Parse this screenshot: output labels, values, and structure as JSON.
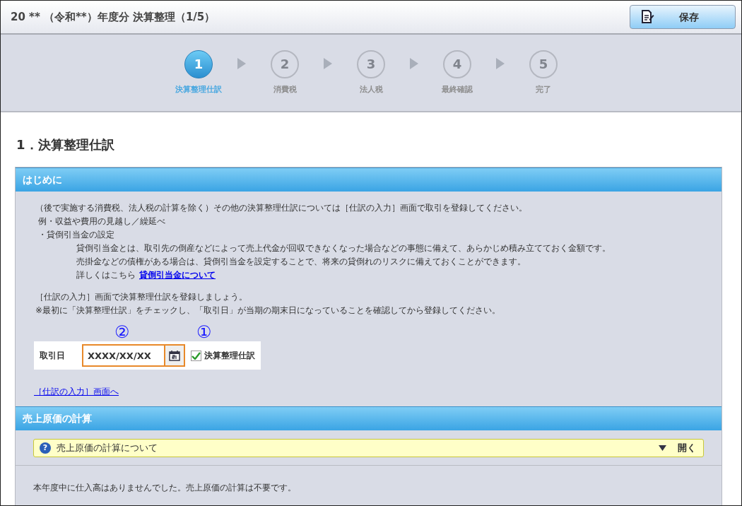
{
  "header": {
    "title": "20 ** （令和**）年度分 決算整理（1/5）",
    "save_button": "保存"
  },
  "steps": [
    {
      "number": "1",
      "label": "決算整理仕訳",
      "selected": true
    },
    {
      "number": "2",
      "label": "消費税",
      "selected": false
    },
    {
      "number": "3",
      "label": "法人税",
      "selected": false
    },
    {
      "number": "4",
      "label": "最終確認",
      "selected": false
    },
    {
      "number": "5",
      "label": "完了",
      "selected": false
    }
  ],
  "page_heading": "1．決算整理仕訳",
  "intro_section": {
    "title": "はじめに",
    "paragraphs": [
      {
        "kind": "text",
        "text": "（後で実施する消費税、法人税の計算を除く）その他の決算整理仕訳については［仕訳の入力］画面で取引を登録してください。",
        "children": [
          {
            "kind": "text",
            "text": "例・収益や費用の見越し／繰延べ"
          },
          {
            "kind": "text",
            "text": "・貸倒引当金の設定",
            "children": [
              {
                "kind": "text",
                "text": "貸倒引当金とは、取引先の倒産などによって売上代金が回収できなくなった場合などの事態に備えて、あらかじめ積み立てておく金額です。"
              },
              {
                "kind": "text",
                "text": "売掛金などの債権がある場合は、貸倒引当金を設定することで、将来の貸倒れのリスクに備えておくことができます。"
              },
              {
                "kind": "link",
                "text": "詳しくはこちら",
                "link": "貸倒引当金について"
              }
            ]
          }
        ]
      }
    ],
    "notes": [
      "［仕訳の入力］画面で決算整理仕訳を登録しましょう。",
      "※最初に「決算整理仕訳」をチェックし、「取引日」が当期の期末日になっていることを確認してから登録してください。"
    ],
    "form": {
      "date_label": "取引日",
      "date_value": "XXXX/XX/XX",
      "date_marker": "②",
      "checkbox_marker": "①",
      "checkbox_label": "決算整理仕訳",
      "checked": true
    },
    "link": "［仕訳の入力］画面へ"
  },
  "cost_section": {
    "title": "売上原価の計算",
    "accordion": {
      "icon": "?",
      "title": "売上原価の計算について",
      "toggle": "開く",
      "expanded": false
    },
    "message": "本年度中に仕入高はありませんでした。売上原価の計算は不要です。"
  }
}
